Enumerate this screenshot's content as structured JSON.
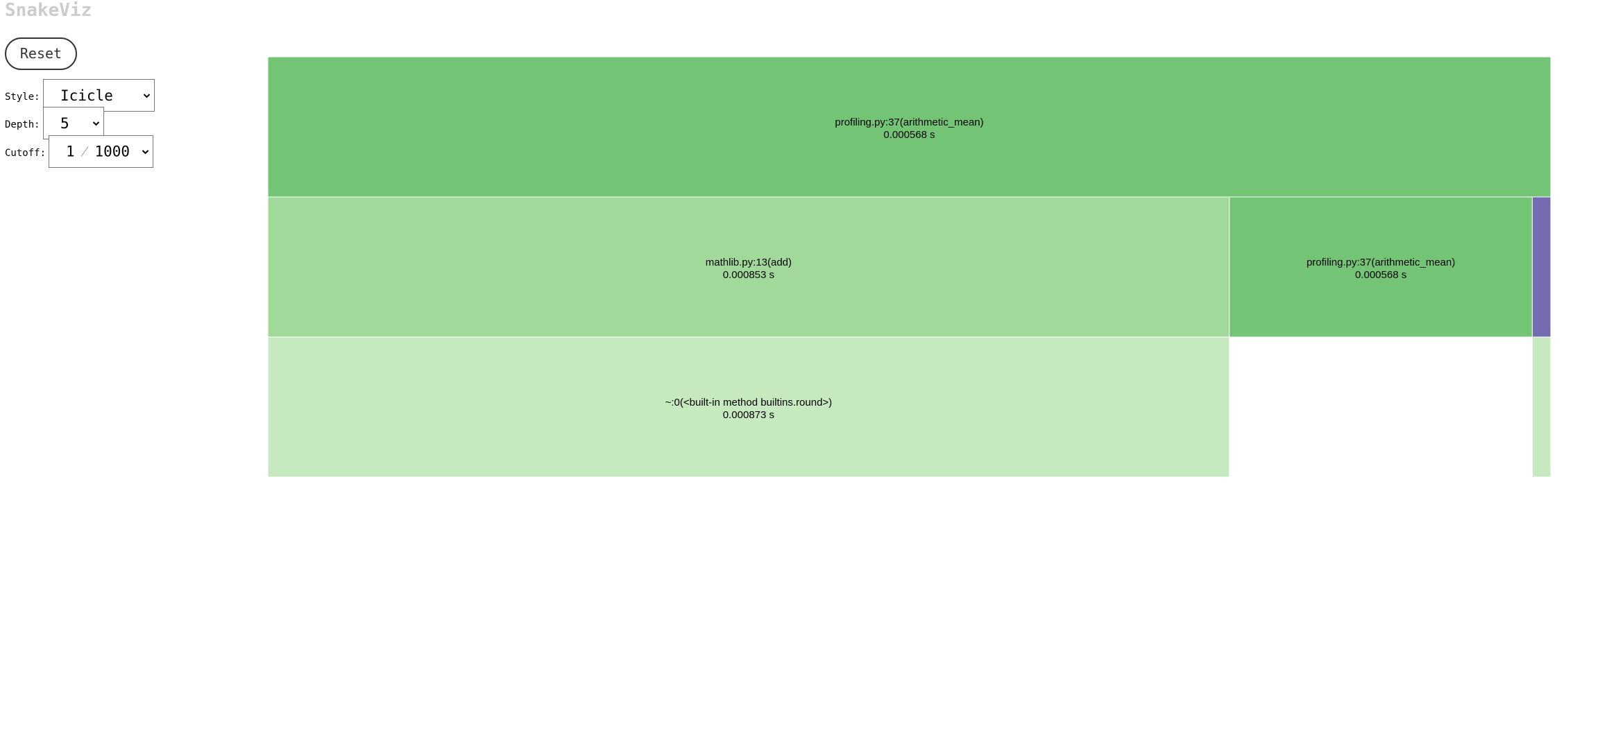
{
  "app": {
    "title": "SnakeViz"
  },
  "controls": {
    "reset_label": "Reset",
    "style_label": "Style:",
    "style_value": "Icicle",
    "depth_label": "Depth:",
    "depth_value": "5",
    "cutoff_label": "Cutoff:",
    "cutoff_numerator": "1",
    "cutoff_separator": "⁄",
    "cutoff_denominator": "1000"
  },
  "colors": {
    "dark_green": "#74c476",
    "mid_green": "#a1d99b",
    "light_green": "#c7e9c0",
    "purple": "#756bb1",
    "title_gray": "#cccccc"
  },
  "icicle": {
    "blocks": [
      {
        "depth": 0,
        "start": 0.0,
        "end": 1.0,
        "color": "dark_green",
        "name": "profiling.py:37(arithmetic_mean)",
        "time": "0.000568 s"
      },
      {
        "depth": 1,
        "start": 0.0,
        "end": 0.7495,
        "color": "mid_green",
        "name": "mathlib.py:13(add)",
        "time": "0.000853 s"
      },
      {
        "depth": 1,
        "start": 0.7495,
        "end": 0.9856,
        "color": "dark_green",
        "name": "profiling.py:37(arithmetic_mean)",
        "time": "0.000568 s"
      },
      {
        "depth": 1,
        "start": 0.9856,
        "end": 1.0,
        "color": "purple",
        "name": "",
        "time": ""
      },
      {
        "depth": 2,
        "start": 0.0,
        "end": 0.7495,
        "color": "light_green",
        "name": "~:0(<built-in method builtins.round>)",
        "time": "0.000873 s"
      },
      {
        "depth": 2,
        "start": 0.9856,
        "end": 1.0,
        "color": "light_green",
        "name": "",
        "time": ""
      }
    ]
  }
}
